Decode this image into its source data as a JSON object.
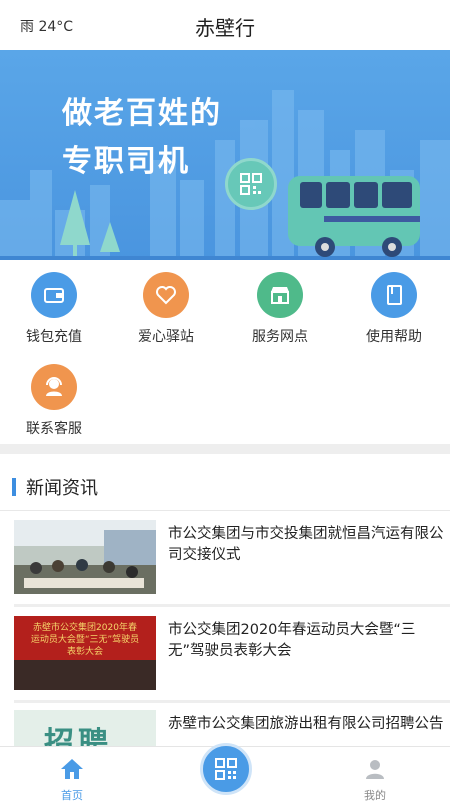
{
  "status": {
    "weather": "雨  24°C"
  },
  "header": {
    "title": "赤壁行"
  },
  "banner": {
    "line1": "做老百姓的",
    "line2": "专职司机"
  },
  "services": [
    {
      "label": "钱包充值",
      "icon": "wallet-icon",
      "color": "#4a9be6"
    },
    {
      "label": "爱心驿站",
      "icon": "heart-icon",
      "color": "#f0954e"
    },
    {
      "label": "服务网点",
      "icon": "store-icon",
      "color": "#4fba8a"
    },
    {
      "label": "使用帮助",
      "icon": "help-book-icon",
      "color": "#4a9be6"
    },
    {
      "label": "联系客服",
      "icon": "customer-service-icon",
      "color": "#f0954e"
    }
  ],
  "news": {
    "title": "新闻资讯",
    "items": [
      {
        "title": "市公交集团与市交投集团就恒昌汽运有限公司交接仪式"
      },
      {
        "title": "市公交集团2020年春运动员大会暨“三无”驾驶员表彰大会",
        "thumb_text": "赤壁市公交集团2020年春运动员大会暨“三无”驾驶员表彰大会"
      },
      {
        "title": "赤壁市公交集团旅游出租有限公司招聘公告",
        "thumb_text": "招聘"
      }
    ]
  },
  "tabbar": {
    "home": "首页",
    "mine": "我的"
  },
  "colors": {
    "accent": "#4a9be6",
    "banner": "#5aa6e8"
  }
}
